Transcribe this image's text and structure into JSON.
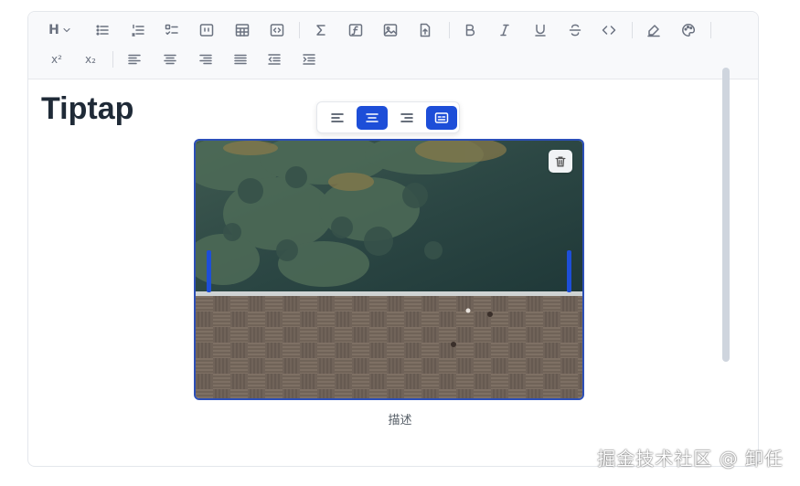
{
  "toolbar": {
    "heading_label": "H",
    "superscript_label": "x²",
    "subscript_label": "x₂",
    "row1_icons": [
      "heading-dropdown-icon",
      "bullet-list-icon",
      "ordered-list-icon",
      "task-list-icon",
      "blockquote-icon",
      "table-icon",
      "code-block-icon",
      "sum-formula-icon",
      "function-formula-icon",
      "image-icon",
      "file-upload-icon",
      "bold-icon",
      "italic-icon",
      "underline-icon",
      "strikethrough-icon",
      "inline-code-icon",
      "highlighter-icon",
      "color-palette-icon"
    ],
    "row2_icons": [
      "superscript-icon",
      "subscript-icon",
      "align-left-icon",
      "align-center-icon",
      "align-right-icon",
      "align-justify-icon",
      "outdent-icon",
      "indent-icon"
    ]
  },
  "document": {
    "title": "Tiptap"
  },
  "image_toolbar": {
    "buttons": [
      "align-left-icon",
      "align-center-icon",
      "align-right-icon",
      "caption-toggle-icon"
    ],
    "active": [
      "align-center-icon",
      "caption-toggle-icon"
    ]
  },
  "image": {
    "caption": "描述"
  },
  "watermark": "掘金技术社区 @ 卸任",
  "colors": {
    "accent": "#1d4ed8",
    "text": "#1f2a37",
    "toolbar_bg": "#f8f9fb"
  }
}
